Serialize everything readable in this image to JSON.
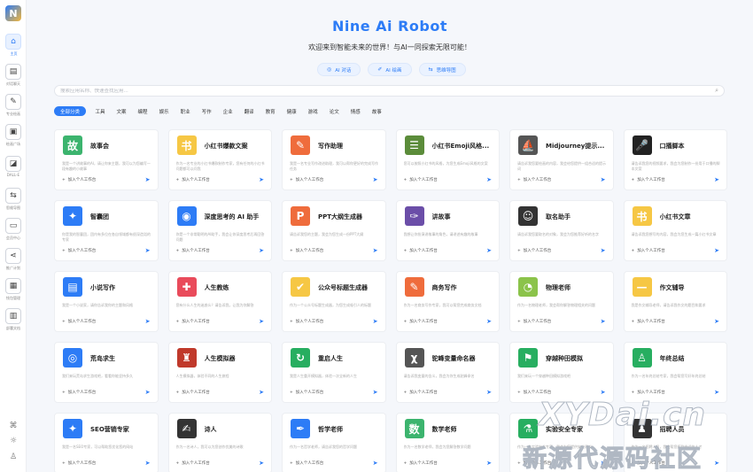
{
  "app": {
    "title": "Nine Ai Robot",
    "subtitle": "欢迎来到智能未来的世界！与AI一同探索无限可能！",
    "logo_text": "N"
  },
  "sidebar": {
    "items": [
      {
        "label": "主页",
        "icon": "home-icon",
        "glyph": "⌂"
      },
      {
        "label": "对话聊天",
        "icon": "chat-icon",
        "glyph": "▤"
      },
      {
        "label": "专业绘画",
        "icon": "paint-icon",
        "glyph": "✎"
      },
      {
        "label": "绘画广场",
        "icon": "gallery-icon",
        "glyph": "▣"
      },
      {
        "label": "DALL-E",
        "icon": "image-icon",
        "glyph": "◪"
      },
      {
        "label": "思维导图",
        "icon": "mindmap-icon",
        "glyph": "⇆"
      },
      {
        "label": "会员中心",
        "icon": "vip-icon",
        "glyph": "▭"
      },
      {
        "label": "推广计划",
        "icon": "share-icon",
        "glyph": "⋖"
      },
      {
        "label": "钱包管理",
        "icon": "wallet-icon",
        "glyph": "▦"
      },
      {
        "label": "部署文档",
        "icon": "doc-icon",
        "glyph": "▥"
      }
    ],
    "bottom_icons": [
      "gift-icon",
      "settings-icon",
      "user-icon"
    ]
  },
  "modes": [
    {
      "label": "AI 对话",
      "icon": "chat-mode-icon",
      "glyph": "◎"
    },
    {
      "label": "AI 绘画",
      "icon": "draw-mode-icon",
      "glyph": "✐"
    },
    {
      "label": "思维导图",
      "icon": "mindmap-mode-icon",
      "glyph": "⇆"
    }
  ],
  "search": {
    "placeholder": "搜索应用名称、快速查找应用..."
  },
  "categories": [
    "全部分类",
    "工具",
    "文案",
    "编程",
    "娱乐",
    "职业",
    "写作",
    "企业",
    "翻译",
    "教育",
    "健康",
    "游戏",
    "论文",
    "情感",
    "故事"
  ],
  "add_label": "加入个人工作台",
  "apps": [
    {
      "title": "故事会",
      "desc": "我是一个讲故事的AI，请让你来主题，我可以为您编写一段有趣的小故事",
      "color": "#3cb46e",
      "glyph": "故"
    },
    {
      "title": "小红书爆款文案",
      "desc": "作为一名专业的小红书爆款制作专家，您有任何的小红书问题都可以问我",
      "color": "#f6c744",
      "glyph": "书"
    },
    {
      "title": "写作助理",
      "desc": "我是一名专业写作改进助理，我可以帮你更好的完成写作任务",
      "color": "#ef6c3c",
      "glyph": "✎"
    },
    {
      "title": "小红书Emoji风格...",
      "desc": "您可以按照小红书的风格，为您生成Emoji风格的文案",
      "color": "#5b8c3a",
      "glyph": "☰"
    },
    {
      "title": "Midjourney提示...",
      "desc": "请告诉我您要绘画的内容，我会给您提供一组合适的提示词",
      "color": "#555",
      "glyph": "⛵"
    },
    {
      "title": "口播脚本",
      "desc": "请告诉我您的视频要求，我会为您制作一份用于口播的脚本文案",
      "color": "#222",
      "glyph": "🎤"
    },
    {
      "title": "智囊团",
      "desc": "你是我的智囊团，团内有多位在各自领域都有很深造诣的专家",
      "color": "#2d7cf6",
      "glyph": "✦"
    },
    {
      "title": "深度思考的 AI 助手",
      "desc": "你是一个非常聪明的AI助手，我会让你深度思考后再回答问题",
      "color": "#2d7cf6",
      "glyph": "◉"
    },
    {
      "title": "PPT大纲生成器",
      "desc": "请告诉我您的主题，我会为您生成一份PPT大纲",
      "color": "#ef6c3c",
      "glyph": "P"
    },
    {
      "title": "讲故事",
      "desc": "我想让你扮演讲故事的角色，请讲述有趣的故事",
      "color": "#6b4ea8",
      "glyph": "✑"
    },
    {
      "title": "取名助手",
      "desc": "请告诉我您要取名的对象，我会为您推荐好听的名字",
      "color": "#333",
      "glyph": "☺"
    },
    {
      "title": "小红书文章",
      "desc": "请告诉我您想写的内容，我会为您生成一篇小红书文章",
      "color": "#f6c744",
      "glyph": "书"
    },
    {
      "title": "小说写作",
      "desc": "我是一个小说家，请你告诉我你的主题和风格",
      "color": "#2d7cf6",
      "glyph": "▤"
    },
    {
      "title": "人生教练",
      "desc": "您有什么人生的迷惑么？请告诉我，让我为你解答",
      "color": "#e94b5b",
      "glyph": "✚"
    },
    {
      "title": "公众号标题生成器",
      "desc": "作为一个公众号标题生成器，为您生成吸引人的标题",
      "color": "#f6c744",
      "glyph": "✔"
    },
    {
      "title": "商务写作",
      "desc": "作为一名商务写作专家，我可以帮您完成商务文档",
      "color": "#ef6c3c",
      "glyph": "✎"
    },
    {
      "title": "物理老师",
      "desc": "作为一名物理老师，我会帮你解答物理相关的问题",
      "color": "#8bc34a",
      "glyph": "◔"
    },
    {
      "title": "作文辅导",
      "desc": "我是作文辅导老师，请告诉我作文的题目和要求",
      "color": "#f6c744",
      "glyph": "—"
    },
    {
      "title": "荒岛求生",
      "desc": "我们来玩荒岛求生游戏吧，看看你能坚持多久",
      "color": "#2d7cf6",
      "glyph": "◎"
    },
    {
      "title": "人生模拟器",
      "desc": "人生模拟器，体验不同的人生旅程",
      "color": "#c0392b",
      "glyph": "♜"
    },
    {
      "title": "重启人生",
      "desc": "我是人生重开模拟器，体验一次全新的人生",
      "color": "#27ae60",
      "glyph": "↻"
    },
    {
      "title": "驼峰变量命名器",
      "desc": "请告诉我变量的含义，我会为你生成驼峰命名",
      "color": "#555",
      "glyph": "χ"
    },
    {
      "title": "穿越种田模拟",
      "desc": "我们来玩一个穿越种田模拟游戏吧",
      "color": "#27ae60",
      "glyph": "⚑"
    },
    {
      "title": "年终总结",
      "desc": "作为一名年终总结专家，我会帮您写好年终总结",
      "color": "#27ae60",
      "glyph": "♙"
    },
    {
      "title": "SEO营销专家",
      "desc": "我是一名SEO专家，可以帮助您优化您的网站",
      "color": "#2d7cf6",
      "glyph": "✦"
    },
    {
      "title": "诗人",
      "desc": "作为一名诗人，我可以为您创作优美的诗歌",
      "color": "#333",
      "glyph": "✍"
    },
    {
      "title": "哲学老师",
      "desc": "作为一名哲学老师，请告诉我您的哲学问题",
      "color": "#2d7cf6",
      "glyph": "✒"
    },
    {
      "title": "数学老师",
      "desc": "作为一名数学老师，我会为您解答数学问题",
      "color": "#3cb46e",
      "glyph": "数"
    },
    {
      "title": "实验安全专家",
      "desc": "作为一名实验安全专家，我会为您提供安全建议",
      "color": "#27ae60",
      "glyph": "⚗"
    },
    {
      "title": "招聘人员",
      "desc": "作为一名招聘人员，我会帮您招到合适的人才",
      "color": "#333",
      "glyph": "♟"
    }
  ],
  "watermark": {
    "line1": "XYDai.cn",
    "line2": "新源代源码社区"
  }
}
